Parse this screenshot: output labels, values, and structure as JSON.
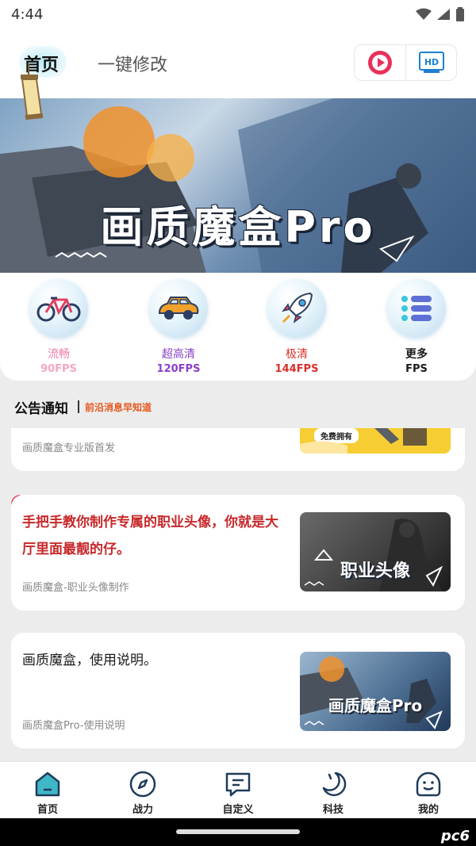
{
  "status_bar": {
    "time": "4:44"
  },
  "header": {
    "tabs": [
      {
        "label": "首页"
      },
      {
        "label": "一键修改"
      }
    ],
    "tools": [
      {
        "icon": "play-icon"
      },
      {
        "icon": "hd-icon",
        "label": "HD"
      }
    ]
  },
  "banner": {
    "title": "画质魔盒Pro"
  },
  "fps_modes": [
    {
      "name": "流畅",
      "fps": "90FPS",
      "icon": "bicycle-icon",
      "color": "#f27aa8"
    },
    {
      "name": "超高清",
      "fps": "120FPS",
      "icon": "car-icon",
      "color": "#8a3fc9"
    },
    {
      "name": "极清",
      "fps": "144FPS",
      "icon": "rocket-icon",
      "color": "#d9302c"
    },
    {
      "name": "更多",
      "fps": "FPS",
      "icon": "list-icon",
      "color": "#1b1b1b"
    }
  ],
  "notice": {
    "title": "公告通知",
    "subtitle": "前沿消息早知道"
  },
  "articles": [
    {
      "source": "画质魔盒专业版首发",
      "thumb_label": "免费拥有"
    },
    {
      "title": "手把手教你制作专属的职业头像，你就是大厅里面最靓的仔。",
      "source": "画质魔盒-职业头像制作",
      "thumb_label": "职业头像",
      "title_color": "#c8282a"
    },
    {
      "title": "画质魔盒，使用说明。",
      "source": "画质魔盒Pro-使用说明",
      "thumb_label": "画质魔盒Pro"
    }
  ],
  "bottom_nav": [
    {
      "label": "首页",
      "icon": "home-icon"
    },
    {
      "label": "战力",
      "icon": "compass-icon"
    },
    {
      "label": "自定义",
      "icon": "chat-icon"
    },
    {
      "label": "科技",
      "icon": "moon-icon"
    },
    {
      "label": "我的",
      "icon": "face-icon"
    }
  ],
  "watermark": {
    "text": "pc6"
  },
  "colors": {
    "accent_teal": "#3fb7c9",
    "notice_orange": "#e8571e",
    "article_red": "#c8282a"
  }
}
